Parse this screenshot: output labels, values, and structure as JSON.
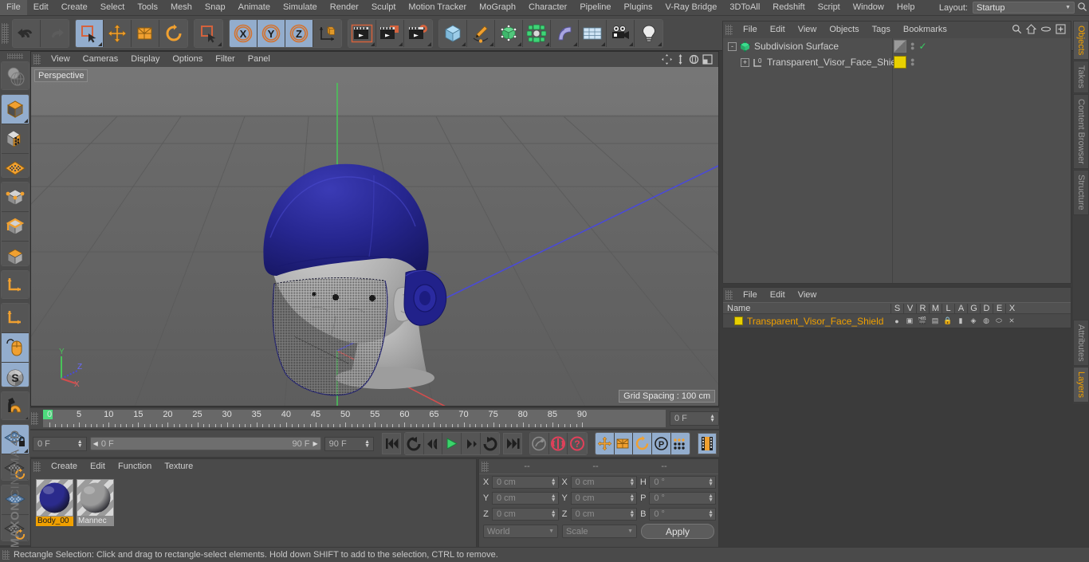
{
  "app": {
    "name": "MAXON CINEMA 4D",
    "logo_brand": "MAXON",
    "logo_product": "CINEMA 4D"
  },
  "menubar": {
    "items": [
      {
        "label": "File"
      },
      {
        "label": "Edit"
      },
      {
        "label": "Create"
      },
      {
        "label": "Select"
      },
      {
        "label": "Tools"
      },
      {
        "label": "Mesh"
      },
      {
        "label": "Snap"
      },
      {
        "label": "Animate"
      },
      {
        "label": "Simulate"
      },
      {
        "label": "Render"
      },
      {
        "label": "Sculpt"
      },
      {
        "label": "Motion Tracker"
      },
      {
        "label": "MoGraph"
      },
      {
        "label": "Character"
      },
      {
        "label": "Pipeline"
      },
      {
        "label": "Plugins"
      },
      {
        "label": "V-Ray Bridge"
      },
      {
        "label": "3DToAll"
      },
      {
        "label": "Redshift"
      },
      {
        "label": "Script"
      },
      {
        "label": "Window"
      },
      {
        "label": "Help"
      }
    ],
    "layout_label": "Layout:",
    "layout_value": "Startup",
    "search_icon": "search-icon"
  },
  "toolbar": {
    "groups": [
      {
        "name": "history",
        "buttons": [
          {
            "name": "undo-button",
            "icon": "undo-icon",
            "selected": false
          },
          {
            "name": "redo-button",
            "icon": "redo-icon",
            "selected": false,
            "disabled": true
          }
        ]
      },
      {
        "name": "select-transform",
        "buttons": [
          {
            "name": "live-selection-button",
            "icon": "rectangle-selection-icon",
            "selected": true
          },
          {
            "name": "move-button",
            "icon": "move-icon",
            "selected": false
          },
          {
            "name": "scale-button",
            "icon": "scale-icon",
            "selected": false
          },
          {
            "name": "rotate-button",
            "icon": "rotate-icon",
            "selected": false
          }
        ]
      },
      {
        "name": "select-mode",
        "buttons": [
          {
            "name": "selection-mode-button",
            "icon": "rectangle-selection-icon",
            "selected": false
          }
        ]
      },
      {
        "name": "axis-lock",
        "buttons": [
          {
            "name": "lock-x-button",
            "icon": "x-axis-icon",
            "selected": true
          },
          {
            "name": "lock-y-button",
            "icon": "y-axis-icon",
            "selected": true
          },
          {
            "name": "lock-z-button",
            "icon": "z-axis-icon",
            "selected": true
          },
          {
            "name": "world-object-coord-button",
            "icon": "world-coordinate-icon",
            "selected": false
          }
        ]
      },
      {
        "name": "render",
        "buttons": [
          {
            "name": "render-view-button",
            "icon": "render-view-icon",
            "selected": false
          },
          {
            "name": "render-to-picture-viewer-button",
            "icon": "render-picture-viewer-icon",
            "selected": false
          },
          {
            "name": "render-settings-button",
            "icon": "render-settings-icon",
            "selected": false
          }
        ]
      },
      {
        "name": "create",
        "buttons": [
          {
            "name": "add-cube-button",
            "icon": "cube-primitive-icon",
            "selected": false
          },
          {
            "name": "add-spline-button",
            "icon": "pen-spline-icon",
            "selected": false
          },
          {
            "name": "add-generator-button",
            "icon": "nurbs-generator-icon",
            "selected": false
          },
          {
            "name": "add-mograph-button",
            "icon": "mograph-cloner-icon",
            "selected": false
          },
          {
            "name": "add-deformer-button",
            "icon": "bend-deformer-icon",
            "selected": false
          },
          {
            "name": "add-environment-button",
            "icon": "floor-environment-icon",
            "selected": false
          },
          {
            "name": "add-camera-button",
            "icon": "camera-icon",
            "selected": false
          },
          {
            "name": "add-light-button",
            "icon": "light-bulb-icon",
            "selected": false
          }
        ]
      }
    ]
  },
  "lefttoolbar": {
    "groups": [
      {
        "buttons": [
          {
            "name": "make-editable-button",
            "icon": "make-editable-icon",
            "selected": false
          }
        ]
      },
      {
        "buttons": [
          {
            "name": "model-mode-button",
            "icon": "model-mode-icon",
            "selected": true
          },
          {
            "name": "texture-mode-button",
            "icon": "texture-mode-icon",
            "selected": false
          },
          {
            "name": "workplane-mode-button",
            "icon": "workplane-icon",
            "selected": false
          }
        ]
      },
      {
        "buttons": [
          {
            "name": "points-mode-button",
            "icon": "points-mode-icon",
            "selected": false
          },
          {
            "name": "edges-mode-button",
            "icon": "edges-mode-icon",
            "selected": false
          },
          {
            "name": "polygons-mode-button",
            "icon": "polygons-mode-icon",
            "selected": false
          }
        ]
      },
      {
        "buttons": [
          {
            "name": "axis-modify-button",
            "icon": "axis-modify-icon",
            "selected": false
          }
        ]
      },
      {
        "buttons": [
          {
            "name": "object-axis-button",
            "icon": "object-axis-icon",
            "selected": false
          },
          {
            "name": "viewport-solo-button",
            "icon": "mouse-icon",
            "selected": true
          },
          {
            "name": "enable-snap-button",
            "icon": "snap-s-icon",
            "selected": true
          }
        ]
      },
      {
        "buttons": [
          {
            "name": "magnet-button",
            "icon": "magnet-icon",
            "selected": false
          }
        ]
      },
      {
        "buttons": [
          {
            "name": "workplane-lock-button",
            "icon": "workplane-lock-icon",
            "selected": true
          },
          {
            "name": "planar-workplane-button",
            "icon": "planar-workplane-icon",
            "selected": false
          }
        ]
      },
      {
        "buttons": [
          {
            "name": "sculpt-mode-button",
            "icon": "sculpt-grid-icon",
            "selected": false
          },
          {
            "name": "sculpt-subdivide-button",
            "icon": "sculpt-subdivide-icon",
            "selected": false
          }
        ]
      }
    ]
  },
  "viewport": {
    "menu": [
      {
        "label": "View"
      },
      {
        "label": "Cameras"
      },
      {
        "label": "Display"
      },
      {
        "label": "Options"
      },
      {
        "label": "Filter"
      },
      {
        "label": "Panel"
      }
    ],
    "nav_icons": [
      {
        "name": "pan-view-icon"
      },
      {
        "name": "dolly-view-icon"
      },
      {
        "name": "rotate-view-icon"
      },
      {
        "name": "maximize-view-icon"
      }
    ],
    "label": "Perspective",
    "grid_spacing": "Grid Spacing : 100 cm",
    "axis_gizmo": {
      "x": "X",
      "y": "Y",
      "z": "Z"
    },
    "scene": {
      "model": "mannequin head with blue headband and transparent face shield visor",
      "headband_color": "#26268f",
      "head_color": "#b4b4b4",
      "visor_note": "transparent dithered visor with selection highlight"
    }
  },
  "timeline": {
    "ticks": [
      0,
      5,
      10,
      15,
      20,
      25,
      30,
      35,
      40,
      45,
      50,
      55,
      60,
      65,
      70,
      75,
      80,
      85,
      90
    ],
    "range_start": 0,
    "range_end": 90,
    "current_frame": "0 F",
    "current_frame_right": "0 F",
    "scroll_start": "0 F",
    "scroll_end": "90 F",
    "preview_end": "90 F"
  },
  "transport": {
    "buttons": [
      {
        "name": "go-to-start-button",
        "icon": "skip-to-start-icon",
        "selected": false
      },
      {
        "name": "play-backwards-loop-button",
        "icon": "loop-back-icon",
        "selected": false
      },
      {
        "name": "go-to-previous-frame-button",
        "icon": "previous-frame-icon",
        "selected": false
      },
      {
        "name": "play-button",
        "icon": "play-icon",
        "selected": false
      },
      {
        "name": "go-to-next-frame-button",
        "icon": "next-frame-icon",
        "selected": false
      },
      {
        "name": "play-forward-loop-button",
        "icon": "loop-forward-icon",
        "selected": false
      },
      {
        "name": "go-to-end-button",
        "icon": "skip-to-end-icon",
        "selected": false
      },
      {
        "name": "record-active-objects-button",
        "icon": "record-key-icon",
        "selected": false
      },
      {
        "name": "autokeying-button",
        "icon": "autokey-icon",
        "selected": false
      },
      {
        "name": "keyframe-selection-button",
        "icon": "keyframe-question-icon",
        "selected": false
      },
      {
        "name": "position-key-button",
        "icon": "position-key-icon",
        "selected": true
      },
      {
        "name": "scale-key-button",
        "icon": "scale-key-icon",
        "selected": true
      },
      {
        "name": "rotation-key-button",
        "icon": "rotation-key-icon",
        "selected": true
      },
      {
        "name": "parameter-key-button",
        "icon": "parameter-key-icon",
        "selected": true
      },
      {
        "name": "point-level-animation-button",
        "icon": "pla-dots-icon",
        "selected": true
      },
      {
        "name": "timeline-toggle-button",
        "icon": "timeline-film-icon",
        "selected": true
      }
    ]
  },
  "materials": {
    "menu": [
      {
        "label": "Create"
      },
      {
        "label": "Edit"
      },
      {
        "label": "Function"
      },
      {
        "label": "Texture"
      }
    ],
    "items": [
      {
        "name": "Body_00",
        "selected": true,
        "color": "#2b2b8c"
      },
      {
        "name": "Mannec",
        "selected": false,
        "color": "#9a9a9a"
      }
    ]
  },
  "coordinates": {
    "headers": [
      "--",
      "--",
      "--"
    ],
    "rows": [
      {
        "left_label": "X",
        "left_value": "0 cm",
        "mid_label": "X",
        "mid_value": "0 cm",
        "right_label": "H",
        "right_value": "0 °"
      },
      {
        "left_label": "Y",
        "left_value": "0 cm",
        "mid_label": "Y",
        "mid_value": "0 cm",
        "right_label": "P",
        "right_value": "0 °"
      },
      {
        "left_label": "Z",
        "left_value": "0 cm",
        "mid_label": "Z",
        "mid_value": "0 cm",
        "right_label": "B",
        "right_value": "0 °"
      }
    ],
    "coord_system": "World",
    "size_mode": "Scale",
    "apply_label": "Apply"
  },
  "objects": {
    "menu": [
      {
        "label": "File"
      },
      {
        "label": "Edit"
      },
      {
        "label": "View"
      },
      {
        "label": "Objects"
      },
      {
        "label": "Tags"
      },
      {
        "label": "Bookmarks"
      }
    ],
    "icons": [
      {
        "name": "search-icon"
      },
      {
        "name": "home-icon"
      },
      {
        "name": "ellipse-icon"
      },
      {
        "name": "add-layer-icon"
      }
    ],
    "tree": [
      {
        "name": "Subdivision Surface",
        "indent": 0,
        "expander": "-",
        "icon": "subdivision-surface-icon",
        "icon_color": "#3adf8e",
        "tag_type": "checker",
        "has_check": true
      },
      {
        "name": "Transparent_Visor_Face_Shield",
        "indent": 1,
        "expander": "+",
        "icon": "polygon-object-icon",
        "icon_color": "#cfcfcf",
        "tag_type": "color",
        "tag_color": "#e8d000",
        "has_check": false
      }
    ]
  },
  "layers": {
    "menu": [
      {
        "label": "File"
      },
      {
        "label": "Edit"
      },
      {
        "label": "View"
      }
    ],
    "columns": [
      "Name",
      "S",
      "V",
      "R",
      "M",
      "L",
      "A",
      "G",
      "D",
      "E",
      "X"
    ],
    "rows": [
      {
        "name": "Transparent_Visor_Face_Shield",
        "color": "#e8d000",
        "text_color": "#f0a000",
        "cells": [
          "solo-dot-icon",
          "visible-icon",
          "render-icon",
          "manager-icon",
          "lock-icon",
          "animation-icon",
          "generator-icon",
          "deformer-icon",
          "expression-icon",
          "xref-icon"
        ]
      }
    ]
  },
  "vtabs": {
    "top": [
      {
        "label": "Objects",
        "active": true
      },
      {
        "label": "Takes",
        "active": false
      },
      {
        "label": "Content Browser",
        "active": false
      },
      {
        "label": "Structure",
        "active": false
      }
    ],
    "bottom": [
      {
        "label": "Attributes",
        "active": false
      },
      {
        "label": "Layers",
        "active": true
      }
    ]
  },
  "statusbar": {
    "text": "Rectangle Selection: Click and drag to rectangle-select elements. Hold down SHIFT to add to the selection, CTRL to remove."
  },
  "colors": {
    "panel_bg": "#4a4a4a",
    "selected_blue": "#93adcd",
    "accent_orange": "#f0a000",
    "viewport_bg": "#6e6e6e",
    "green_playhead": "#4ddb7d"
  }
}
